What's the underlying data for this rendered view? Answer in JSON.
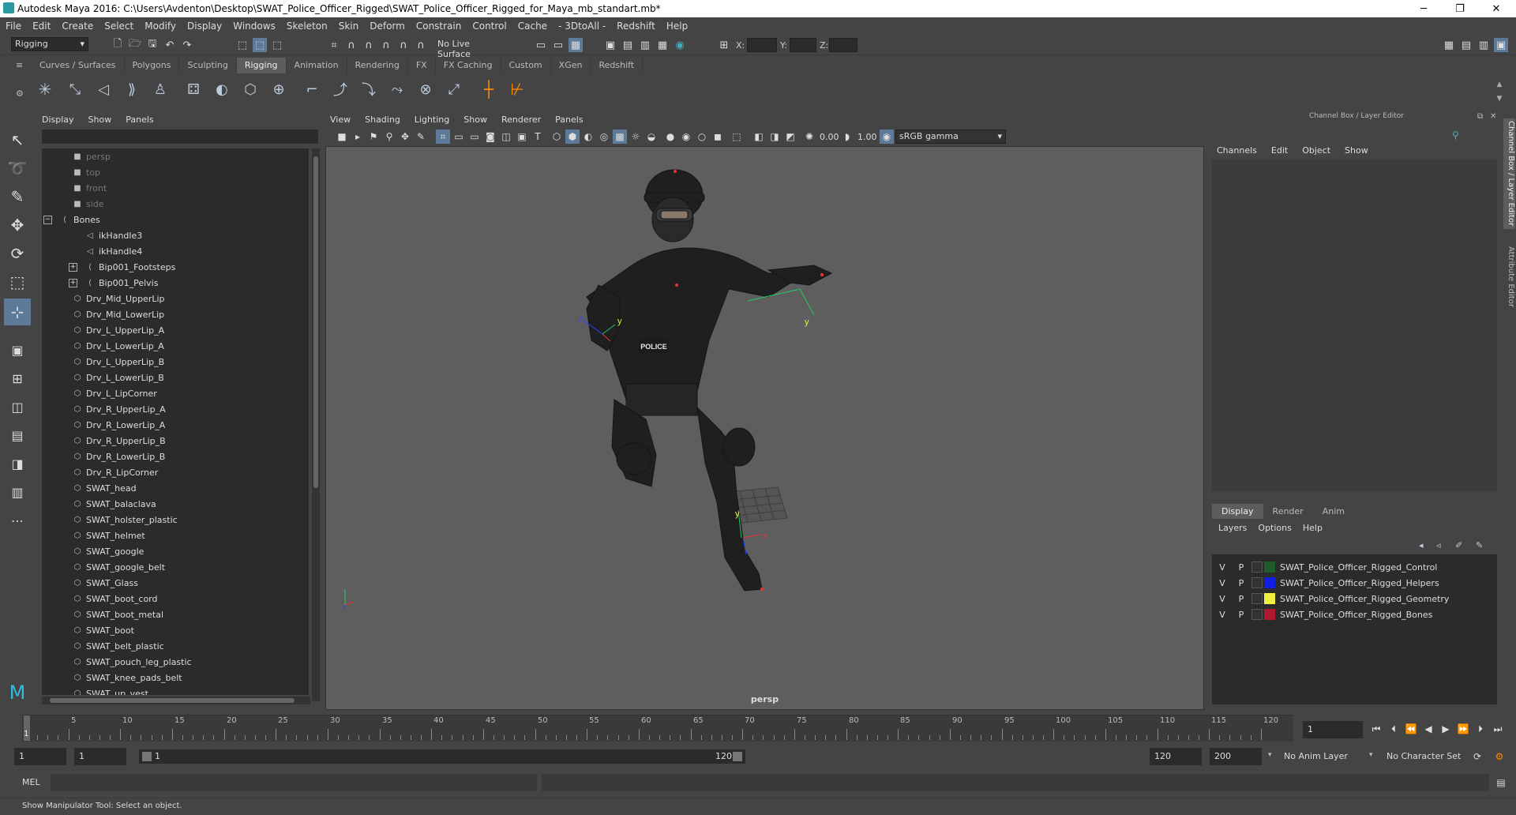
{
  "window": {
    "title": "Autodesk Maya 2016: C:\\Users\\Avdenton\\Desktop\\SWAT_Police_Officer_Rigged\\SWAT_Police_Officer_Rigged_for_Maya_mb_standart.mb*",
    "minimize": "─",
    "maximize": "❐",
    "close": "✕"
  },
  "menubar": [
    "File",
    "Edit",
    "Create",
    "Select",
    "Modify",
    "Display",
    "Windows",
    "Skeleton",
    "Skin",
    "Deform",
    "Constrain",
    "Control",
    "Cache",
    "- 3DtoAll -",
    "Redshift",
    "Help"
  ],
  "statusline": {
    "mode": "Rigging",
    "live_surface": "No Live Surface",
    "x_label": "X:",
    "y_label": "Y:",
    "z_label": "Z:"
  },
  "shelf_tabs": [
    "Curves / Surfaces",
    "Polygons",
    "Sculpting",
    "Rigging",
    "Animation",
    "Rendering",
    "FX",
    "FX Caching",
    "Custom",
    "XGen",
    "Redshift"
  ],
  "shelf_active": "Rigging",
  "outliner": {
    "menu": [
      "Display",
      "Show",
      "Panels"
    ],
    "items": [
      {
        "label": "persp",
        "indent": 2,
        "icon": "camera-icon",
        "dim": true
      },
      {
        "label": "top",
        "indent": 2,
        "icon": "camera-icon",
        "dim": true
      },
      {
        "label": "front",
        "indent": 2,
        "icon": "camera-icon",
        "dim": true
      },
      {
        "label": "side",
        "indent": 2,
        "icon": "camera-icon",
        "dim": true
      },
      {
        "label": "Bones",
        "indent": 1,
        "icon": "joint-icon",
        "expand": "−"
      },
      {
        "label": "ikHandle3",
        "indent": 3,
        "icon": "ikhandle-icon"
      },
      {
        "label": "ikHandle4",
        "indent": 3,
        "icon": "ikhandle-icon"
      },
      {
        "label": "Bip001_Footsteps",
        "indent": 3,
        "icon": "joint-icon",
        "expand": "+"
      },
      {
        "label": "Bip001_Pelvis",
        "indent": 3,
        "icon": "joint-icon",
        "expand": "+"
      },
      {
        "label": "Drv_Mid_UpperLip",
        "indent": 2,
        "icon": "mesh-icon"
      },
      {
        "label": "Drv_Mid_LowerLip",
        "indent": 2,
        "icon": "mesh-icon"
      },
      {
        "label": "Drv_L_UpperLip_A",
        "indent": 2,
        "icon": "mesh-icon"
      },
      {
        "label": "Drv_L_LowerLip_A",
        "indent": 2,
        "icon": "mesh-icon"
      },
      {
        "label": "Drv_L_UpperLip_B",
        "indent": 2,
        "icon": "mesh-icon"
      },
      {
        "label": "Drv_L_LowerLip_B",
        "indent": 2,
        "icon": "mesh-icon"
      },
      {
        "label": "Drv_L_LipCorner",
        "indent": 2,
        "icon": "mesh-icon"
      },
      {
        "label": "Drv_R_UpperLip_A",
        "indent": 2,
        "icon": "mesh-icon"
      },
      {
        "label": "Drv_R_LowerLip_A",
        "indent": 2,
        "icon": "mesh-icon"
      },
      {
        "label": "Drv_R_UpperLip_B",
        "indent": 2,
        "icon": "mesh-icon"
      },
      {
        "label": "Drv_R_LowerLip_B",
        "indent": 2,
        "icon": "mesh-icon"
      },
      {
        "label": "Drv_R_LipCorner",
        "indent": 2,
        "icon": "mesh-icon"
      },
      {
        "label": "SWAT_head",
        "indent": 2,
        "icon": "mesh-icon"
      },
      {
        "label": "SWAT_balaclava",
        "indent": 2,
        "icon": "mesh-icon"
      },
      {
        "label": "SWAT_holster_plastic",
        "indent": 2,
        "icon": "mesh-icon"
      },
      {
        "label": "SWAT_helmet",
        "indent": 2,
        "icon": "mesh-icon"
      },
      {
        "label": "SWAT_google",
        "indent": 2,
        "icon": "mesh-icon"
      },
      {
        "label": "SWAT_google_belt",
        "indent": 2,
        "icon": "mesh-icon"
      },
      {
        "label": "SWAT_Glass",
        "indent": 2,
        "icon": "mesh-icon"
      },
      {
        "label": "SWAT_boot_cord",
        "indent": 2,
        "icon": "mesh-icon"
      },
      {
        "label": "SWAT_boot_metal",
        "indent": 2,
        "icon": "mesh-icon"
      },
      {
        "label": "SWAT_boot",
        "indent": 2,
        "icon": "mesh-icon"
      },
      {
        "label": "SWAT_belt_plastic",
        "indent": 2,
        "icon": "mesh-icon"
      },
      {
        "label": "SWAT_pouch_leg_plastic",
        "indent": 2,
        "icon": "mesh-icon"
      },
      {
        "label": "SWAT_knee_pads_belt",
        "indent": 2,
        "icon": "mesh-icon"
      },
      {
        "label": "SWAT_up_vest",
        "indent": 2,
        "icon": "mesh-icon"
      }
    ]
  },
  "viewport": {
    "menu": [
      "View",
      "Shading",
      "Lighting",
      "Show",
      "Renderer",
      "Panels"
    ],
    "exposure": "0.00",
    "gamma": "1.00",
    "color_space": "sRGB gamma",
    "camera_label": "persp",
    "vest_text": "POLICE",
    "axis_labels": {
      "x": "x",
      "y": "y",
      "z": "z"
    }
  },
  "channelbox": {
    "title": "Channel Box / Layer Editor",
    "menu": [
      "Channels",
      "Edit",
      "Object",
      "Show"
    ],
    "layer_tabs": [
      "Display",
      "Render",
      "Anim"
    ],
    "layer_tab_active": "Display",
    "layer_menu": [
      "Layers",
      "Options",
      "Help"
    ],
    "layers": [
      {
        "v": "V",
        "p": "P",
        "name": "SWAT_Police_Officer_Rigged_Control",
        "color": "#1e5c2a"
      },
      {
        "v": "V",
        "p": "P",
        "name": "SWAT_Police_Officer_Rigged_Helpers",
        "color": "#1020e0"
      },
      {
        "v": "V",
        "p": "P",
        "name": "SWAT_Police_Officer_Rigged_Geometry",
        "color": "#f0f040"
      },
      {
        "v": "V",
        "p": "P",
        "name": "SWAT_Police_Officer_Rigged_Bones",
        "color": "#b01830"
      }
    ]
  },
  "side_tabs": [
    "Channel Box / Layer Editor",
    "Attribute Editor"
  ],
  "timeline": {
    "labels": [
      "5",
      "10",
      "15",
      "20",
      "25",
      "30",
      "35",
      "40",
      "45",
      "50",
      "55",
      "60",
      "65",
      "70",
      "75",
      "80",
      "85",
      "90",
      "95",
      "100",
      "105",
      "110",
      "115",
      "120"
    ],
    "current_frame_marker": "1",
    "current_frame": "1",
    "start": 1,
    "end": 120
  },
  "range": {
    "start": "1",
    "playback_start": "1",
    "slider_start": "1",
    "slider_end": "120",
    "playback_end": "120",
    "end": "200",
    "anim_layer": "No Anim Layer",
    "character_set": "No Character Set"
  },
  "command": {
    "label": "MEL"
  },
  "help_line": "Show Manipulator Tool: Select an object."
}
